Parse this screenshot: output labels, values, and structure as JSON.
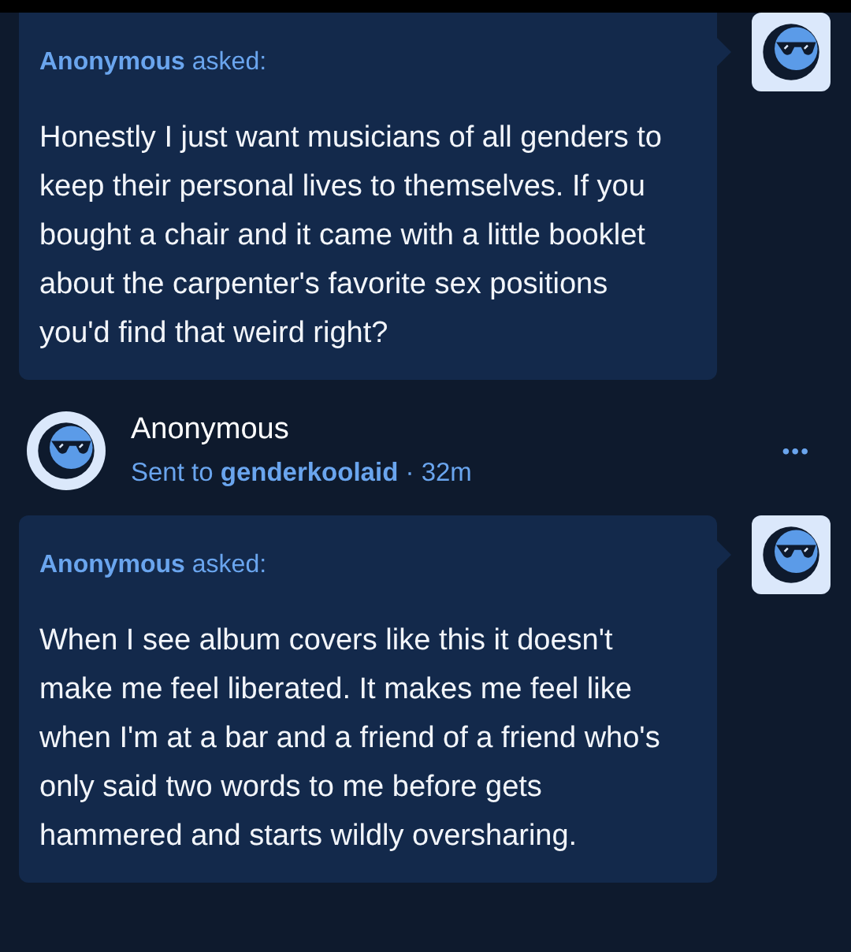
{
  "asks": [
    {
      "asker": "**Anonymous** asked:",
      "question": "Honestly I just want musicians of all genders to keep their personal lives to themselves. If you bought a chair and it came with a little booklet about the carpenter's favorite sex positions you'd find that weird right?"
    }
  ],
  "post": {
    "author": "Anonymous",
    "meta": "Sent to **genderkoolaid** · 32m",
    "menu": "•••",
    "ask": {
      "asker": "**Anonymous** asked:",
      "question": "When I see album covers like this it doesn't make me feel liberated. It makes me feel like when I'm at a bar and a friend of a friend who's only said two words to me before gets hammered and starts wildly oversharing."
    }
  }
}
